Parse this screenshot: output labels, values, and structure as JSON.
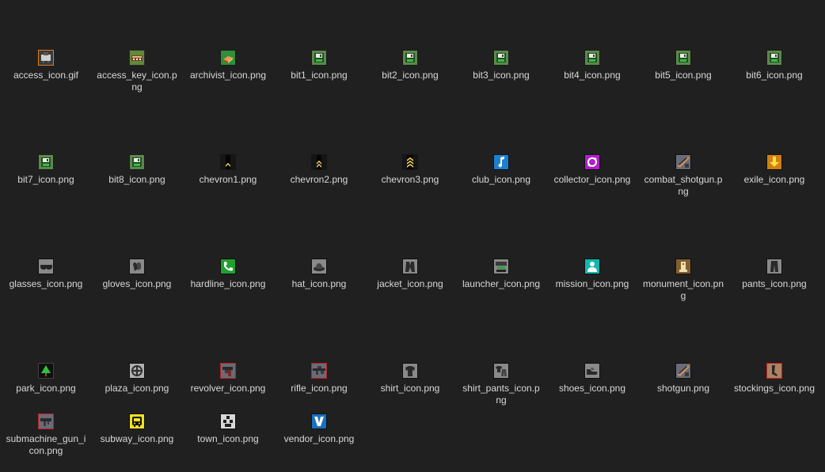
{
  "files": [
    {
      "name": "access_icon.gif",
      "icon": "access-icon",
      "bg": "#3a3a3a",
      "border": "#e07a20",
      "fg": "#cfcfcf"
    },
    {
      "name": "access_key_icon.png",
      "icon": "access-key-icon",
      "bg": "#5f8a3a",
      "border": "#2a2a2a",
      "fg": "#d8c080"
    },
    {
      "name": "archivist_icon.png",
      "icon": "book-icon",
      "bg": "#2f8f3a",
      "border": "#1a1a1a",
      "fg": "#e89a50"
    },
    {
      "name": "bit1_icon.png",
      "icon": "disk-icon",
      "bg": "#5a8a4a",
      "border": "#1a1a1a",
      "fg": "#e8f0e0"
    },
    {
      "name": "bit2_icon.png",
      "icon": "disk-icon",
      "bg": "#5a8a4a",
      "border": "#1a1a1a",
      "fg": "#e8f0e0"
    },
    {
      "name": "bit3_icon.png",
      "icon": "disk-icon",
      "bg": "#5a8a4a",
      "border": "#1a1a1a",
      "fg": "#e8f0e0"
    },
    {
      "name": "bit4_icon.png",
      "icon": "disk-icon",
      "bg": "#5a8a4a",
      "border": "#1a1a1a",
      "fg": "#e8f0e0"
    },
    {
      "name": "bit5_icon.png",
      "icon": "disk-icon",
      "bg": "#5a8a4a",
      "border": "#1a1a1a",
      "fg": "#e8f0e0"
    },
    {
      "name": "bit6_icon.png",
      "icon": "disk-icon",
      "bg": "#5a8a4a",
      "border": "#1a1a1a",
      "fg": "#e8f0e0"
    },
    {
      "name": "bit7_icon.png",
      "icon": "disk-icon",
      "bg": "#5a8a4a",
      "border": "#1a1a1a",
      "fg": "#e8f0e0"
    },
    {
      "name": "bit8_icon.png",
      "icon": "disk-icon",
      "bg": "#5a8a4a",
      "border": "#1a1a1a",
      "fg": "#e8f0e0"
    },
    {
      "name": "chevron1.png",
      "icon": "chevron1-icon",
      "bg": "#151515",
      "border": "#151515",
      "fg": "#f0d060"
    },
    {
      "name": "chevron2.png",
      "icon": "chevron2-icon",
      "bg": "#151515",
      "border": "#151515",
      "fg": "#f0d060"
    },
    {
      "name": "chevron3.png",
      "icon": "chevron3-icon",
      "bg": "#151515",
      "border": "#151515",
      "fg": "#f0d060"
    },
    {
      "name": "club_icon.png",
      "icon": "music-note-icon",
      "bg": "#1c7fd0",
      "border": "#101010",
      "fg": "#ffffff"
    },
    {
      "name": "collector_icon.png",
      "icon": "collector-icon",
      "bg": "#b020c8",
      "border": "#101010",
      "fg": "#ffffff"
    },
    {
      "name": "combat_shotgun.png",
      "icon": "shotgun-icon",
      "bg": "#6a6a78",
      "border": "#101010",
      "fg": "#c09060"
    },
    {
      "name": "exile_icon.png",
      "icon": "down-arrow-icon",
      "bg": "#d08010",
      "border": "#101010",
      "fg": "#ffe040"
    },
    {
      "name": "glasses_icon.png",
      "icon": "glasses-icon",
      "bg": "#8a8a8a",
      "border": "#101010",
      "fg": "#222222"
    },
    {
      "name": "gloves_icon.png",
      "icon": "gloves-icon",
      "bg": "#8a8a8a",
      "border": "#101010",
      "fg": "#2a2a2a"
    },
    {
      "name": "hardline_icon.png",
      "icon": "phone-icon",
      "bg": "#20a030",
      "border": "#101010",
      "fg": "#ffffff"
    },
    {
      "name": "hat_icon.png",
      "icon": "hat-icon",
      "bg": "#8a8a8a",
      "border": "#101010",
      "fg": "#2a2a2a"
    },
    {
      "name": "jacket_icon.png",
      "icon": "jacket-icon",
      "bg": "#8a8a8a",
      "border": "#101010",
      "fg": "#2a2a2a"
    },
    {
      "name": "launcher_icon.png",
      "icon": "launcher-icon",
      "bg": "#8a8a8a",
      "border": "#101010",
      "fg": "#3a3a3a"
    },
    {
      "name": "mission_icon.png",
      "icon": "person-icon",
      "bg": "#10b8b0",
      "border": "#101010",
      "fg": "#ffffff"
    },
    {
      "name": "monument_icon.png",
      "icon": "monument-icon",
      "bg": "#806030",
      "border": "#101010",
      "fg": "#f0e0b0"
    },
    {
      "name": "pants_icon.png",
      "icon": "pants-icon",
      "bg": "#8a8a8a",
      "border": "#101010",
      "fg": "#2a2a2a"
    },
    {
      "name": "park_icon.png",
      "icon": "tree-icon",
      "bg": "#101010",
      "border": "#404040",
      "fg": "#30c040"
    },
    {
      "name": "plaza_icon.png",
      "icon": "plaza-icon",
      "bg": "#b0b0b0",
      "border": "#101010",
      "fg": "#303030"
    },
    {
      "name": "revolver_icon.png",
      "icon": "revolver-icon",
      "bg": "#6a6a78",
      "border": "#c02020",
      "fg": "#2a2a2a"
    },
    {
      "name": "rifle_icon.png",
      "icon": "rifle-icon",
      "bg": "#6a6a78",
      "border": "#c02020",
      "fg": "#2a2a2a"
    },
    {
      "name": "shirt_icon.png",
      "icon": "shirt-icon",
      "bg": "#8a8a8a",
      "border": "#101010",
      "fg": "#2a2a2a"
    },
    {
      "name": "shirt_pants_icon.png",
      "icon": "shirt-pants-icon",
      "bg": "#8a8a8a",
      "border": "#101010",
      "fg": "#2a2a2a"
    },
    {
      "name": "shoes_icon.png",
      "icon": "shoes-icon",
      "bg": "#8a8a8a",
      "border": "#101010",
      "fg": "#2a2a2a"
    },
    {
      "name": "shotgun.png",
      "icon": "shotgun-icon",
      "bg": "#6a6a78",
      "border": "#101010",
      "fg": "#c09060"
    },
    {
      "name": "stockings_icon.png",
      "icon": "stockings-icon",
      "bg": "#b08060",
      "border": "#c02020",
      "fg": "#2a2a2a"
    },
    {
      "name": "submachine_gun_icon.png",
      "icon": "smg-icon",
      "bg": "#6a6a78",
      "border": "#c02020",
      "fg": "#2a2a2a"
    },
    {
      "name": "subway_icon.png",
      "icon": "subway-icon",
      "bg": "#f0e020",
      "border": "#101010",
      "fg": "#101010"
    },
    {
      "name": "town_icon.png",
      "icon": "town-icon",
      "bg": "#d8d8d8",
      "border": "#101010",
      "fg": "#202020"
    },
    {
      "name": "vendor_icon.png",
      "icon": "vendor-icon",
      "bg": "#1870c0",
      "border": "#101010",
      "fg": "#ffffff"
    }
  ]
}
